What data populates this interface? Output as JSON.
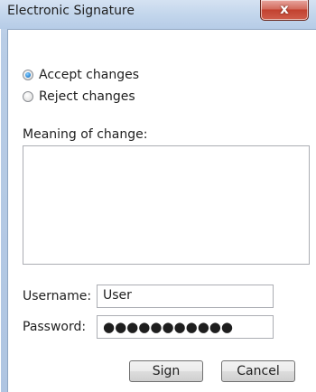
{
  "window": {
    "title": "Electronic Signature",
    "close_glyph": "x"
  },
  "decision": {
    "options": [
      {
        "label": "Accept changes",
        "checked": true
      },
      {
        "label": "Reject changes",
        "checked": false
      }
    ]
  },
  "meaning": {
    "label": "Meaning of change:",
    "value": ""
  },
  "username": {
    "label": "Username:",
    "value": "User"
  },
  "password": {
    "label": "Password:",
    "masked_value": "●●●●●●●●●●●"
  },
  "buttons": {
    "sign": "Sign",
    "cancel": "Cancel"
  },
  "colors": {
    "accent": "#2f8cd8",
    "close": "#c2412f"
  }
}
